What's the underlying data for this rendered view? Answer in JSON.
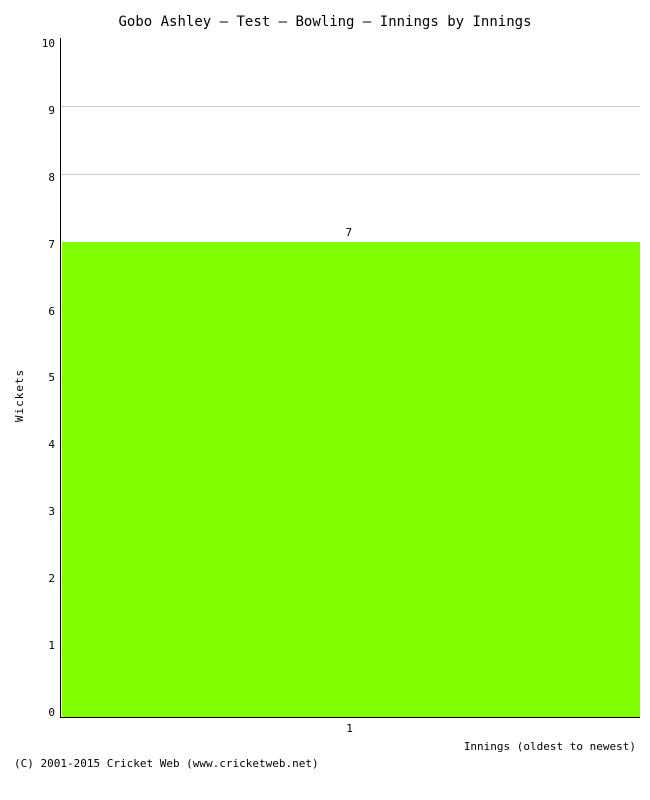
{
  "chart": {
    "title": "Gobo Ashley – Test – Bowling – Innings by Innings",
    "y_axis_label": "Wickets",
    "x_axis_label": "Innings (oldest to newest)",
    "y_max": 10,
    "y_ticks": [
      10,
      9,
      8,
      7,
      6,
      5,
      4,
      3,
      2,
      1,
      0
    ],
    "bar_value": 7,
    "bar_label": "7",
    "bar_x_tick": "1",
    "copyright": "(C) 2001-2015 Cricket Web (www.cricketweb.net)"
  }
}
